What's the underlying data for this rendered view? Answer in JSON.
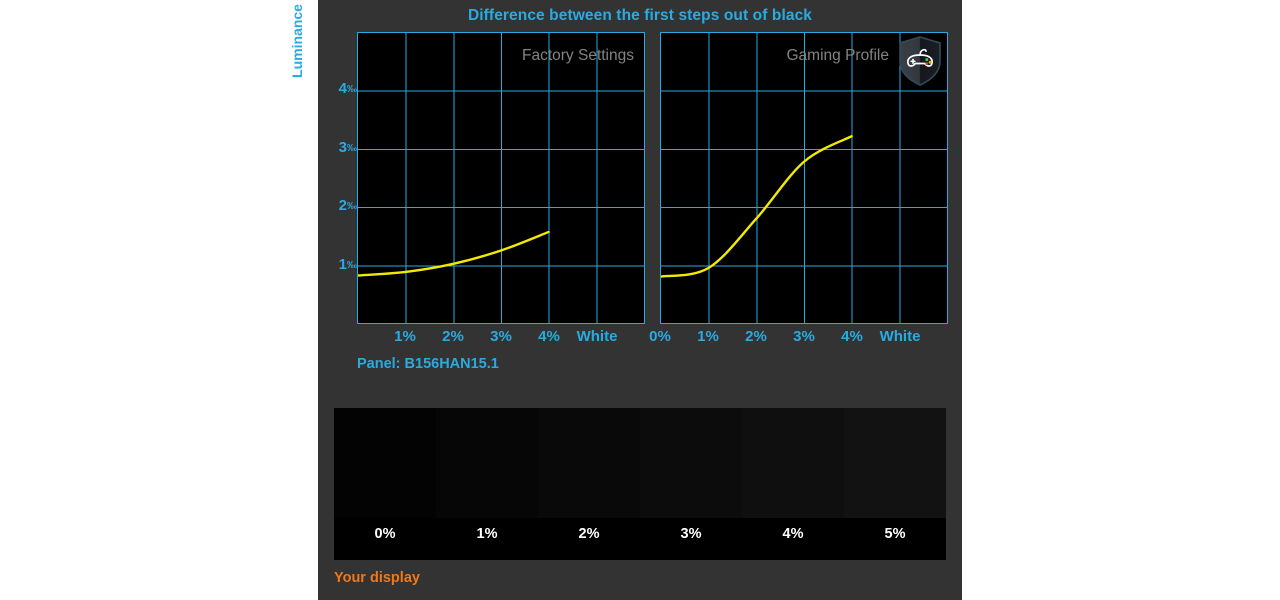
{
  "title": "Difference between the first steps out of black",
  "colors": {
    "accent_cyan": "#29abe2",
    "curve_yellow": "#f2ea00",
    "panel_bg": "#333333",
    "plot_bg": "#000000",
    "label_gray": "#838383",
    "your_display_orange": "#f07818"
  },
  "y_axis": {
    "label": "Luminance",
    "ticks": [
      "1",
      "2",
      "3",
      "4"
    ],
    "unit": "‰"
  },
  "charts": [
    {
      "id": "factory",
      "label": "Factory Settings",
      "badge": null,
      "x_ticks": [
        "1%",
        "2%",
        "3%",
        "4%",
        "White"
      ]
    },
    {
      "id": "gaming",
      "label": "Gaming Profile",
      "badge": "gamepad-shield-icon",
      "x_ticks": [
        "0%",
        "1%",
        "2%",
        "3%",
        "4%",
        "White"
      ]
    }
  ],
  "panel_info": "Panel: B156HAN15.1",
  "black_strip": {
    "labels": [
      "0%",
      "1%",
      "2%",
      "3%",
      "4%",
      "5%"
    ],
    "swatches": [
      "#030303",
      "#060606",
      "#090909",
      "#0c0c0c",
      "#0f0f0f",
      "#121212"
    ]
  },
  "footer_label": "Your display",
  "chart_data": {
    "type": "line",
    "title": "Difference between the first steps out of black",
    "xlabel": "",
    "ylabel": "Luminance",
    "yunit": "‰",
    "ylim": [
      0,
      5
    ],
    "ygrid": [
      1,
      2,
      3,
      4
    ],
    "grid": true,
    "legend_position": "inside-top-right",
    "panels": [
      {
        "name": "Factory Settings",
        "x": [
          "0%",
          "1%",
          "2%",
          "3%",
          "4%",
          "White"
        ],
        "x_visible_ticks": [
          "1%",
          "2%",
          "3%",
          "4%",
          "White"
        ],
        "series": [
          {
            "name": "Luminance",
            "color": "#f2ea00",
            "points": [
              {
                "x": "0%",
                "y": 0.82
              },
              {
                "x": "1%",
                "y": 0.88
              },
              {
                "x": "2%",
                "y": 1.02
              },
              {
                "x": "3%",
                "y": 1.25
              },
              {
                "x": "4%",
                "y": 1.57
              }
            ]
          }
        ]
      },
      {
        "name": "Gaming Profile",
        "x": [
          "0%",
          "1%",
          "2%",
          "3%",
          "4%",
          "White"
        ],
        "x_visible_ticks": [
          "0%",
          "1%",
          "2%",
          "3%",
          "4%",
          "White"
        ],
        "series": [
          {
            "name": "Luminance",
            "color": "#f2ea00",
            "points": [
              {
                "x": "0%",
                "y": 0.8
              },
              {
                "x": "1%",
                "y": 0.95
              },
              {
                "x": "2%",
                "y": 1.8
              },
              {
                "x": "3%",
                "y": 2.78
              },
              {
                "x": "4%",
                "y": 3.22
              }
            ]
          }
        ]
      }
    ]
  }
}
